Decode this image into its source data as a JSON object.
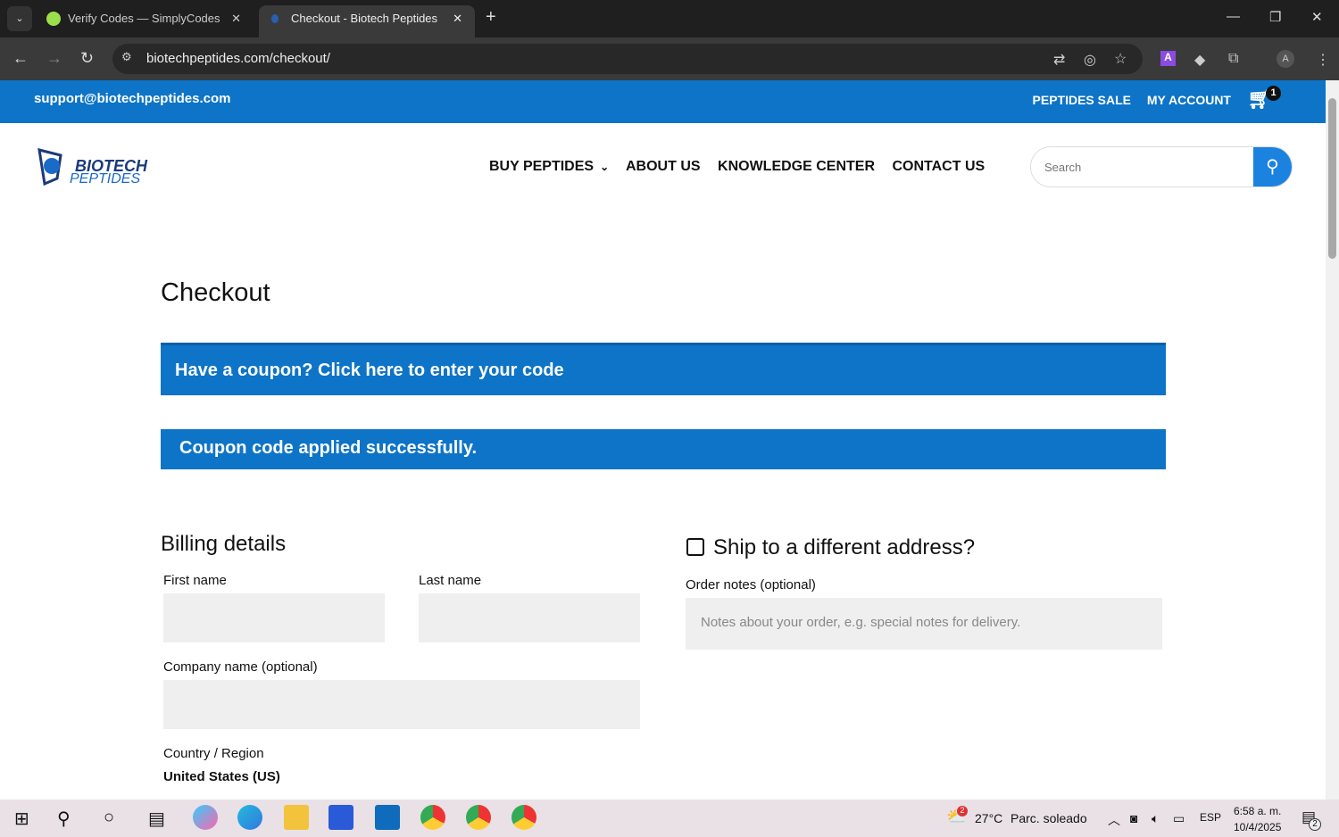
{
  "browser": {
    "tabs": [
      {
        "title": "Verify Codes — SimplyCodes"
      },
      {
        "title": "Checkout - Biotech Peptides"
      }
    ],
    "url": "biotechpeptides.com/checkout/"
  },
  "topbar": {
    "email": "support@biotechpeptides.com",
    "links": [
      "PEPTIDES SALE",
      "MY ACCOUNT"
    ],
    "cart_count": "1"
  },
  "logo": {
    "line1": "BIOTECH",
    "line2": "PEPTIDES"
  },
  "nav": [
    "BUY PEPTIDES",
    "ABOUT US",
    "KNOWLEDGE CENTER",
    "CONTACT US"
  ],
  "search": {
    "placeholder": "Search"
  },
  "page": {
    "title": "Checkout",
    "coupon_notice": "Have a coupon? Click here to enter your code",
    "coupon_success": "Coupon code applied successfully."
  },
  "billing": {
    "heading": "Billing details",
    "first_name": "First name",
    "last_name": "Last name",
    "company": "Company name (optional)",
    "country_label": "Country / Region",
    "country_value": "United States (US)"
  },
  "shipping": {
    "heading": "Ship to a different address?",
    "notes_label": "Order notes (optional)",
    "notes_placeholder": "Notes about your order, e.g. special notes for delivery."
  },
  "taskbar": {
    "weather": "27°C",
    "weather_desc": "Parc. soleado",
    "lang": "ESP",
    "time": "6:58 a. m.",
    "date": "10/4/2025",
    "notif_count": "2",
    "weather_badge": "2"
  }
}
